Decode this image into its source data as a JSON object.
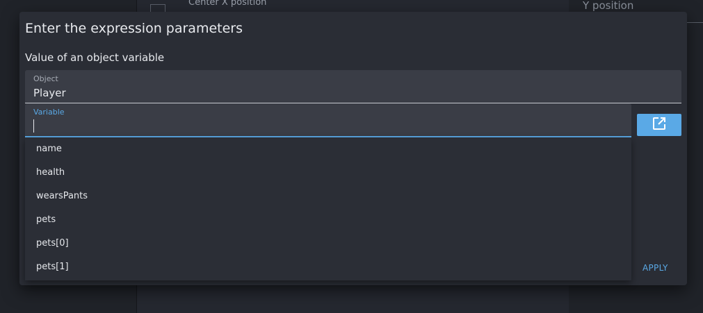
{
  "background": {
    "row_label": "Center X position",
    "right_field_label": "Y position"
  },
  "dialog": {
    "title": "Enter the expression parameters",
    "subtitle": "Value of an object variable",
    "object_field": {
      "label": "Object",
      "value": "Player"
    },
    "variable_field": {
      "label": "Variable",
      "value": "",
      "placeholder": ""
    },
    "open_button_icon": "open-in-new-icon",
    "suggestions": [
      "name",
      "health",
      "wearsPants",
      "pets",
      "pets[0]",
      "pets[1]"
    ],
    "apply_label": "APPLY"
  },
  "colors": {
    "accent": "#5aa9e6",
    "dialog_bg": "#2a2d35",
    "field_bg": "#3a3d46"
  }
}
